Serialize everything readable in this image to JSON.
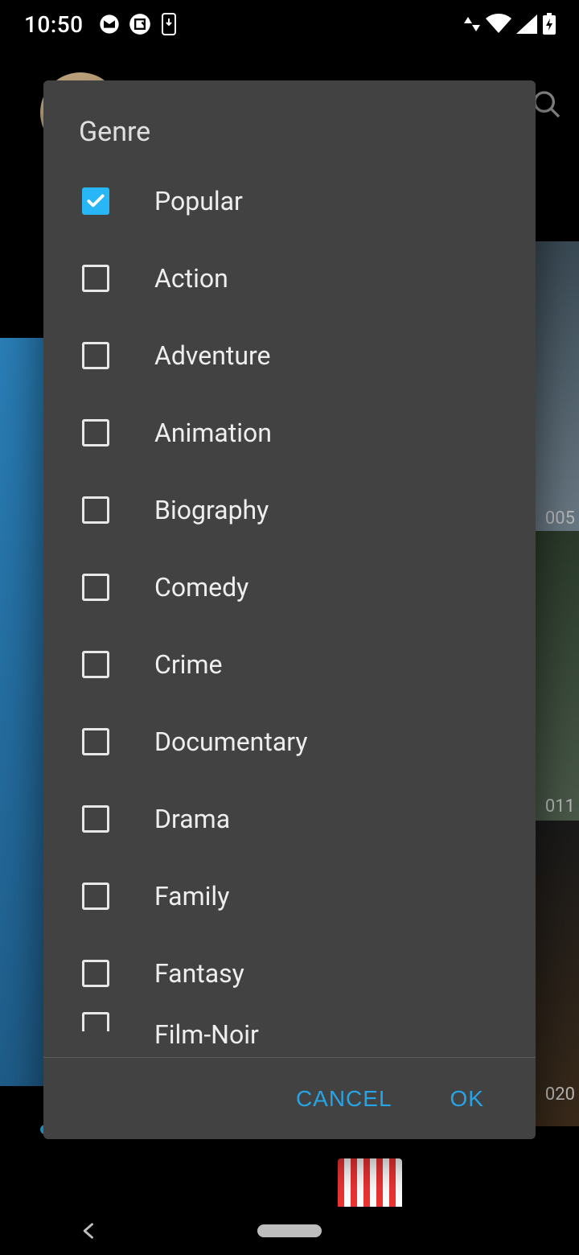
{
  "status": {
    "time": "10:50",
    "wifi_badge": "5"
  },
  "background": {
    "year1": "005",
    "year2": "011",
    "year3": "020"
  },
  "dialog": {
    "title": "Genre",
    "cancel": "CANCEL",
    "ok": "OK",
    "genres": [
      {
        "label": "Popular",
        "checked": true
      },
      {
        "label": "Action",
        "checked": false
      },
      {
        "label": "Adventure",
        "checked": false
      },
      {
        "label": "Animation",
        "checked": false
      },
      {
        "label": "Biography",
        "checked": false
      },
      {
        "label": "Comedy",
        "checked": false
      },
      {
        "label": "Crime",
        "checked": false
      },
      {
        "label": "Documentary",
        "checked": false
      },
      {
        "label": "Drama",
        "checked": false
      },
      {
        "label": "Family",
        "checked": false
      },
      {
        "label": "Fantasy",
        "checked": false
      },
      {
        "label": "Film-Noir",
        "checked": false
      }
    ]
  }
}
